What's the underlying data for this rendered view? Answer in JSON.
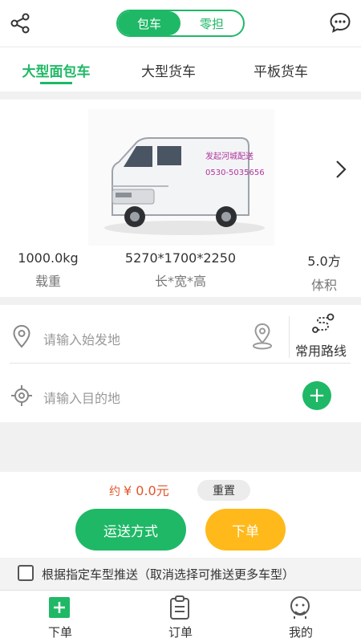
{
  "header": {
    "segments": [
      {
        "label": "包车",
        "active": true
      },
      {
        "label": "零担",
        "active": false
      }
    ]
  },
  "tabs": [
    {
      "label": "大型面包车",
      "active": true
    },
    {
      "label": "大型货车",
      "active": false
    },
    {
      "label": "平板货车",
      "active": false
    }
  ],
  "vehicle": {
    "van_text_1": "发起河城配送",
    "van_text_2": "0530-5035656",
    "specs": [
      {
        "value": "1000.0kg",
        "label": "载重"
      },
      {
        "value": "5270*1700*2250",
        "label": "长*宽*高"
      },
      {
        "value": "5.0方",
        "label": "体积"
      }
    ]
  },
  "route": {
    "start_placeholder": "请输入始发地",
    "end_placeholder": "请输入目的地",
    "common_routes_label": "常用路线"
  },
  "order": {
    "price_prefix": "约",
    "price": "¥ 0.0元",
    "reset_label": "重置",
    "transport_label": "运送方式",
    "submit_label": "下单"
  },
  "option": {
    "checked": false,
    "label": "根据指定车型推送（取消选择可推送更多车型）"
  },
  "bottom_nav": [
    {
      "label": "下单",
      "icon": "plus-square-icon",
      "active": true
    },
    {
      "label": "订单",
      "icon": "clipboard-icon",
      "active": false
    },
    {
      "label": "我的",
      "icon": "user-face-icon",
      "active": false
    }
  ],
  "colors": {
    "accent": "#1fb866",
    "orange": "#ffb91a",
    "price": "#e2562a"
  }
}
